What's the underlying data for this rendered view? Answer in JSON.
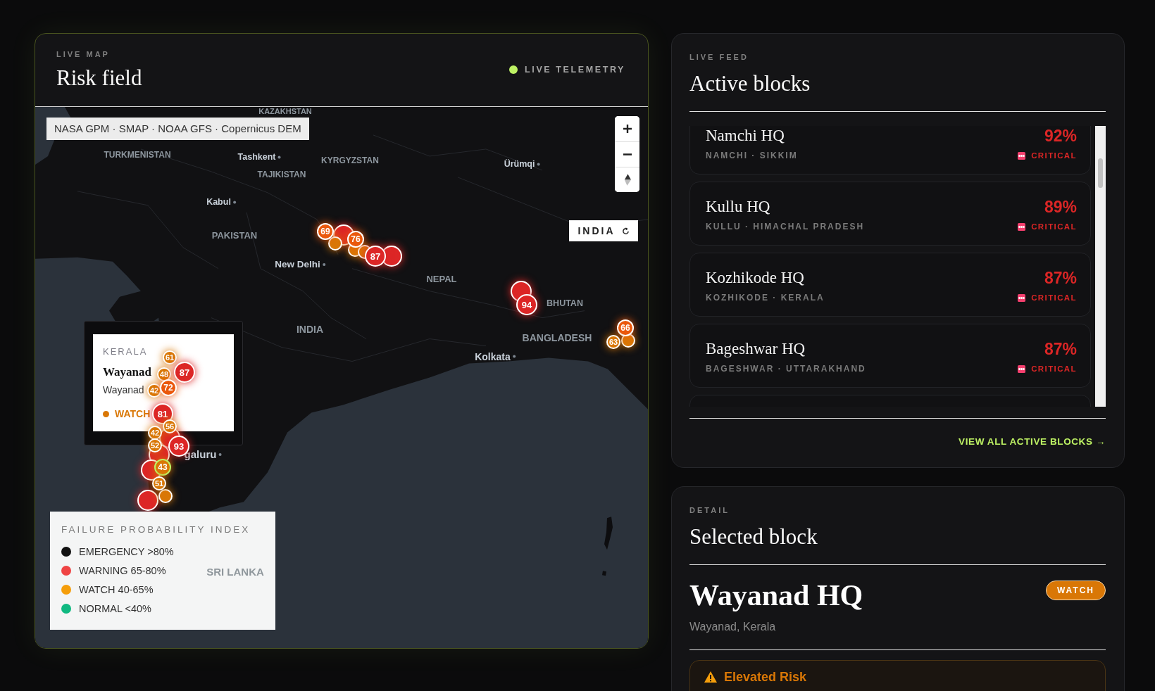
{
  "map_panel": {
    "eyebrow": "LIVE MAP",
    "title": "Risk field",
    "status": {
      "label": "LIVE TELEMETRY",
      "live": true
    },
    "attribution": "NASA GPM · SMAP · NOAA GFS · Copernicus DEM",
    "region_button": "INDIA",
    "places": [
      {
        "name": "KAZAKHSTAN",
        "kind": "country"
      },
      {
        "name": "TURKMENISTAN",
        "kind": "country"
      },
      {
        "name": "Tashkent",
        "kind": "city"
      },
      {
        "name": "KYRGYZSTAN",
        "kind": "country"
      },
      {
        "name": "TAJIKISTAN",
        "kind": "country"
      },
      {
        "name": "Ürümqi",
        "kind": "city"
      },
      {
        "name": "Kabul",
        "kind": "city"
      },
      {
        "name": "PAKISTAN",
        "kind": "country"
      },
      {
        "name": "New Delhi",
        "kind": "city"
      },
      {
        "name": "NEPAL",
        "kind": "country"
      },
      {
        "name": "BHUTAN",
        "kind": "country"
      },
      {
        "name": "INDIA",
        "kind": "country"
      },
      {
        "name": "BANGLADESH",
        "kind": "country"
      },
      {
        "name": "Kolkata",
        "kind": "city"
      },
      {
        "name": "galuru",
        "kind": "city"
      },
      {
        "name": "SRI LANKA",
        "kind": "faint"
      }
    ],
    "markers": [
      {
        "color": "#dc2626",
        "selected": false
      },
      {
        "color": "#d97706",
        "selected": false
      },
      {
        "color": "#d97706",
        "selected": false
      },
      {
        "color": "#d97706",
        "selected": false
      },
      {
        "color": "#dc2626",
        "selected": false
      },
      {
        "label": "69",
        "color": "#ea580c",
        "selected": false
      },
      {
        "label": "76",
        "color": "#ea580c",
        "selected": false
      },
      {
        "label": "87",
        "color": "#dc2626",
        "selected": false
      },
      {
        "color": "#dc2626",
        "selected": false
      },
      {
        "label": "94",
        "color": "#dc2626",
        "selected": false
      },
      {
        "color": "#d97706",
        "selected": false
      },
      {
        "label": "66",
        "color": "#ea580c",
        "selected": false
      },
      {
        "label": "63",
        "color": "#d97706",
        "selected": false
      },
      {
        "color": "#dc2626",
        "selected": false
      },
      {
        "color": "#dc2626",
        "selected": false
      },
      {
        "color": "#dc2626",
        "selected": false
      },
      {
        "color": "#dc2626",
        "selected": false
      },
      {
        "color": "#d97706",
        "selected": false
      },
      {
        "label": "61",
        "color": "#d97706",
        "selected": false
      },
      {
        "label": "48",
        "color": "#d97706",
        "selected": false
      },
      {
        "label": "87",
        "color": "#dc2626",
        "selected": false
      },
      {
        "label": "42",
        "color": "#d97706",
        "selected": false
      },
      {
        "label": "72",
        "color": "#ea580c",
        "selected": false
      },
      {
        "label": "81",
        "color": "#dc2626",
        "selected": false
      },
      {
        "label": "56",
        "color": "#d97706",
        "selected": false
      },
      {
        "label": "42",
        "color": "#d97706",
        "selected": false
      },
      {
        "label": "52",
        "color": "#d97706",
        "selected": false
      },
      {
        "label": "93",
        "color": "#dc2626",
        "selected": false
      },
      {
        "label": "43",
        "color": "#d97706",
        "selected": true
      },
      {
        "label": "51",
        "color": "#d97706",
        "selected": false
      }
    ],
    "popup": {
      "region": "KERALA",
      "title": "Wayanad",
      "subtitle": "Wayanad",
      "status": "WATCH",
      "color": "#d97706"
    },
    "legend": {
      "title": "FAILURE PROBABILITY INDEX",
      "items": [
        {
          "label": "EMERGENCY >80%",
          "color": "#111111"
        },
        {
          "label": "WARNING 65-80%",
          "color": "#ef4444"
        },
        {
          "label": "WATCH 40-65%",
          "color": "#f59e0b"
        },
        {
          "label": "NORMAL <40%",
          "color": "#10b981"
        }
      ]
    }
  },
  "feed_panel": {
    "eyebrow": "LIVE FEED",
    "title": "Active blocks",
    "blocks": [
      {
        "name": "Namchi HQ",
        "location": "NAMCHI · SIKKIM",
        "probability": "92%",
        "status": "CRITICAL"
      },
      {
        "name": "Kullu HQ",
        "location": "KULLU · HIMACHAL PRADESH",
        "probability": "89%",
        "status": "CRITICAL"
      },
      {
        "name": "Kozhikode HQ",
        "location": "KOZHIKODE · KERALA",
        "probability": "87%",
        "status": "CRITICAL"
      },
      {
        "name": "Bageshwar HQ",
        "location": "BAGESHWAR · UTTARAKHAND",
        "probability": "87%",
        "status": "CRITICAL"
      }
    ],
    "link": "VIEW ALL ACTIVE BLOCKS →"
  },
  "detail_panel": {
    "eyebrow": "DETAIL",
    "title": "Selected block",
    "block": {
      "name": "Wayanad HQ",
      "location": "Wayanad, Kerala",
      "status": "WATCH",
      "color": "#d97706"
    },
    "alert": {
      "title": "Elevated Risk"
    }
  }
}
